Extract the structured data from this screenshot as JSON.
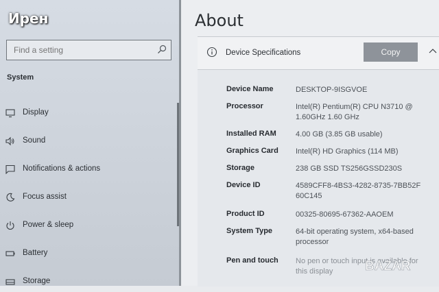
{
  "overlay_user": "Ирен",
  "sidebar": {
    "search_placeholder": "Find a setting",
    "section_title": "System",
    "items": [
      {
        "label": "Display",
        "icon": "monitor-icon"
      },
      {
        "label": "Sound",
        "icon": "speaker-icon"
      },
      {
        "label": "Notifications & actions",
        "icon": "notification-icon"
      },
      {
        "label": "Focus assist",
        "icon": "moon-icon"
      },
      {
        "label": "Power & sleep",
        "icon": "power-icon"
      },
      {
        "label": "Battery",
        "icon": "battery-icon"
      },
      {
        "label": "Storage",
        "icon": "storage-icon"
      }
    ]
  },
  "main": {
    "title": "About",
    "panel": {
      "title": "Device Specifications",
      "copy_label": "Copy",
      "specs": [
        {
          "label": "Device Name",
          "value": "DESKTOP-9ISGVOE"
        },
        {
          "label": "Processor",
          "value": "Intel(R) Pentium(R) CPU N3710 @ 1.60GHz 1.60 GHz"
        },
        {
          "label": "Installed RAM",
          "value": "4.00 GB (3.85 GB usable)"
        },
        {
          "label": "Graphics Card",
          "value": "Intel(R) HD Graphics (114 MB)"
        },
        {
          "label": "Storage",
          "value": "238 GB SSD TS256GSSD230S"
        },
        {
          "label": "Device ID",
          "value": "4589CFF8-4BS3-4282-8735-7BB52F60C145"
        },
        {
          "label": "Product ID",
          "value": "00325-80695-67362-AAOEM"
        },
        {
          "label": "System Type",
          "value": "64-bit operating system, x64-based processor"
        },
        {
          "label": "Pen and touch",
          "value": "No pen or touch input is available for this display"
        }
      ]
    }
  },
  "logo_text": "BAZAR",
  "colors": {
    "copy_button": "#8e939a",
    "sidebar_bg": "#d0d6de",
    "panel_header": "#f1f2f4"
  }
}
